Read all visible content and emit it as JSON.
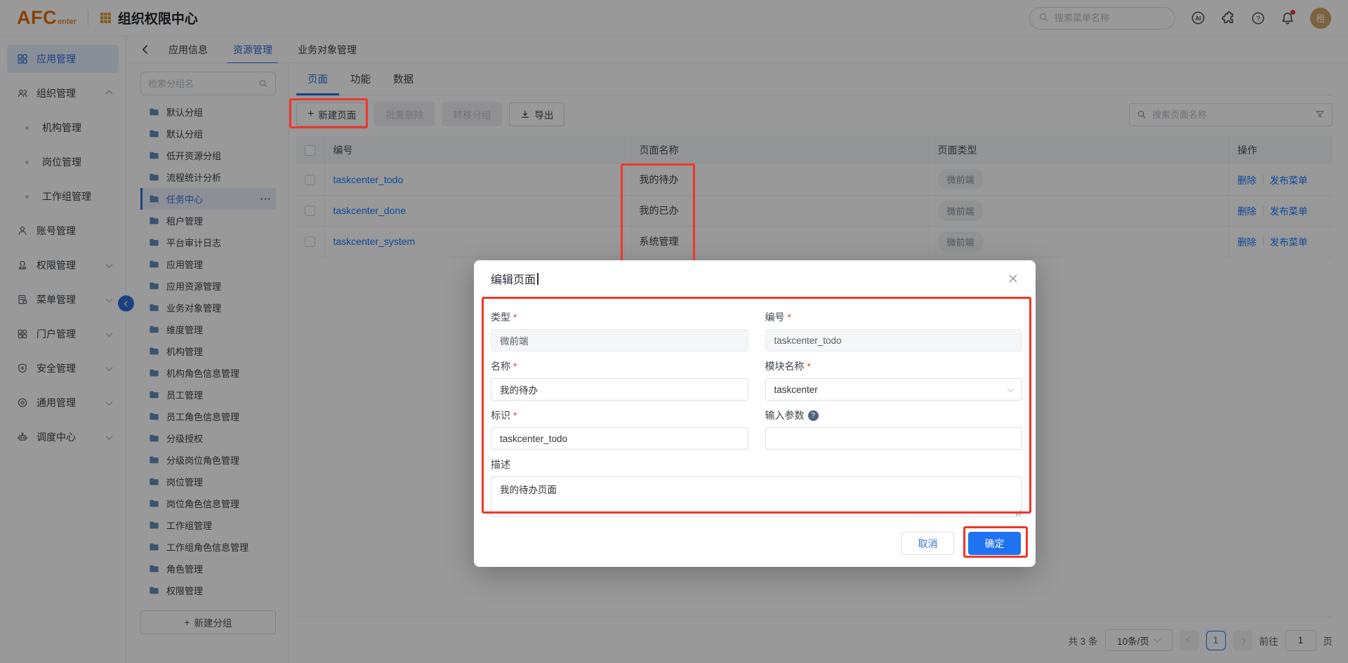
{
  "topbar": {
    "logo_main": "AFC",
    "logo_sub": "enter",
    "app_title": "组织权限中心",
    "search_placeholder": "搜索菜单名称",
    "avatar_text": "租"
  },
  "sidebar": {
    "items": [
      {
        "id": "app-management",
        "label": "应用管理",
        "icon": "grid",
        "active": true
      },
      {
        "id": "org-management",
        "label": "组织管理",
        "icon": "people",
        "arrow": "up"
      },
      {
        "id": "org-structure",
        "label": "机构管理",
        "child": true
      },
      {
        "id": "position-management",
        "label": "岗位管理",
        "child": true
      },
      {
        "id": "workgroup-management",
        "label": "工作组管理",
        "child": true
      },
      {
        "id": "account-management",
        "label": "账号管理",
        "icon": "person"
      },
      {
        "id": "permission-management",
        "label": "权限管理",
        "icon": "seal",
        "arrow": "down"
      },
      {
        "id": "menu-management",
        "label": "菜单管理",
        "icon": "doc",
        "arrow": "down"
      },
      {
        "id": "portal-management",
        "label": "门户管理",
        "icon": "portal",
        "arrow": "down"
      },
      {
        "id": "security-management",
        "label": "安全管理",
        "icon": "shield",
        "arrow": "down"
      },
      {
        "id": "general-management",
        "label": "通用管理",
        "icon": "gear",
        "arrow": "down"
      },
      {
        "id": "dispatch-center",
        "label": "调度中心",
        "icon": "robot",
        "arrow": "down"
      }
    ]
  },
  "tabs": {
    "items": [
      "应用信息",
      "资源管理",
      "业务对象管理"
    ],
    "active_index": 1
  },
  "group_panel": {
    "search_placeholder": "检索分组名",
    "selected_index": 4,
    "groups": [
      "默认分组",
      "默认分组",
      "低开资源分组",
      "流程统计分析",
      "任务中心",
      "租户管理",
      "平台审计日志",
      "应用管理",
      "应用资源管理",
      "业务对象管理",
      "维度管理",
      "机构管理",
      "机构角色信息管理",
      "员工管理",
      "员工角色信息管理",
      "分级授权",
      "分级岗位角色管理",
      "岗位管理",
      "岗位角色信息管理",
      "工作组管理",
      "工作组角色信息管理",
      "角色管理",
      "权限管理"
    ],
    "more_menu": "···",
    "new_group_label": "新建分组"
  },
  "subtabs": {
    "items": [
      "页面",
      "功能",
      "数据"
    ],
    "active_index": 0
  },
  "toolbar": {
    "new_page": "新建页面",
    "batch_delete": "批量删除",
    "transfer_group": "转移分组",
    "export": "导出",
    "search_placeholder": "搜索页面名称"
  },
  "table": {
    "headers": [
      "编号",
      "页面名称",
      "页面类型",
      "操作"
    ],
    "rows": [
      {
        "code": "taskcenter_todo",
        "name": "我的待办",
        "type": "微前端",
        "actions": [
          "删除",
          "发布菜单"
        ]
      },
      {
        "code": "taskcenter_done",
        "name": "我的已办",
        "type": "微前端",
        "actions": [
          "删除",
          "发布菜单"
        ]
      },
      {
        "code": "taskcenter_system",
        "name": "系统管理",
        "type": "微前端",
        "actions": [
          "删除",
          "发布菜单"
        ]
      }
    ]
  },
  "pagination": {
    "total": "共 3 条",
    "page_size": "10条/页",
    "current_page": "1",
    "goto_label": "前往",
    "goto_value": "1",
    "goto_unit": "页"
  },
  "modal": {
    "title": "编辑页面",
    "fields": {
      "type": {
        "label": "类型",
        "value": "微前端",
        "disabled": true,
        "required": true
      },
      "code": {
        "label": "编号",
        "value": "taskcenter_todo",
        "disabled": true,
        "required": true
      },
      "name": {
        "label": "名称",
        "value": "我的待办",
        "required": true
      },
      "module": {
        "label": "模块名称",
        "value": "taskcenter",
        "required": true,
        "select": true
      },
      "identifier": {
        "label": "标识",
        "value": "taskcenter_todo",
        "required": true
      },
      "params": {
        "label": "输入参数",
        "value": "",
        "help": true
      },
      "description": {
        "label": "描述",
        "value": "我的待办页面"
      }
    },
    "cancel_label": "取消",
    "ok_label": "确定"
  },
  "colors": {
    "accent_blue": "#1677ff",
    "annotation_red": "#f1352b",
    "logo_orange": "#e2710f",
    "grid_gold": "#d29a2a",
    "folder_blue": "#5e8cba"
  }
}
